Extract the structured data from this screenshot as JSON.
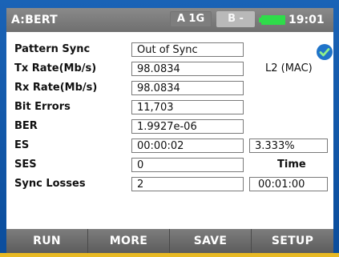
{
  "header": {
    "title": "A:BERT",
    "port_a": "A 1G",
    "port_b": "B -",
    "time": "19:01"
  },
  "rows": [
    {
      "label": "Pattern Sync",
      "value": "Out of Sync"
    },
    {
      "label": "Tx Rate(Mb/s)",
      "value": "98.0834"
    },
    {
      "label": "Rx Rate(Mb/s)",
      "value": "98.0834"
    },
    {
      "label": "Bit Errors",
      "value": "11,703"
    },
    {
      "label": "BER",
      "value": "1.9927e-06"
    },
    {
      "label": "ES",
      "value": "00:00:02"
    },
    {
      "label": "SES",
      "value": "0"
    },
    {
      "label": "Sync Losses",
      "value": "2"
    }
  ],
  "side": {
    "layer": "L2 (MAC)",
    "es_percent": "3.333%",
    "time_label": "Time",
    "elapsed_time": "00:01:00"
  },
  "softkeys": [
    "RUN",
    "MORE",
    "SAVE",
    "SETUP"
  ],
  "colors": {
    "accent_blue": "#0d55a8",
    "header_gray": "#7a7a7a",
    "battery_green": "#2fdc4a",
    "check_circle": "#1f73c9"
  },
  "icons": {
    "status": "checkmark-circle-icon",
    "battery": "battery-icon"
  }
}
